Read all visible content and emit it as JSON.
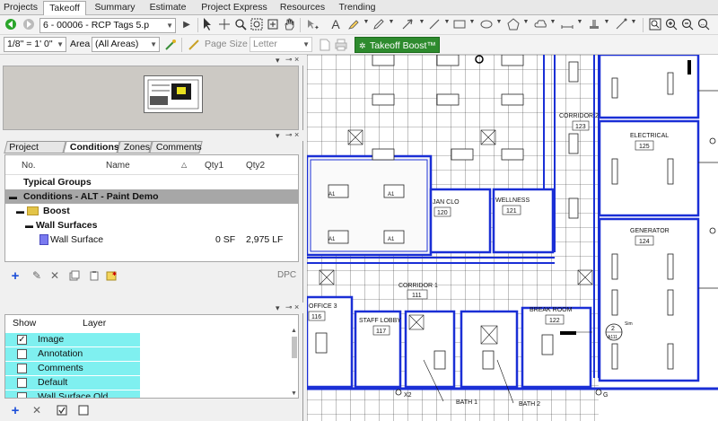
{
  "tabs": [
    "Projects",
    "Takeoff",
    "Summary",
    "Estimate",
    "Project Express",
    "Resources",
    "Trending"
  ],
  "active_tab": "Takeoff",
  "toolbar": {
    "page_select": "6 - 00006 - RCP Tags 5.p",
    "scale": "1/8\" = 1' 0\"",
    "area_label": "Area",
    "area_value": "(All Areas)",
    "page_size_label": "Page Size",
    "page_size_value": "Letter",
    "boost_label": "Takeoff Boost™"
  },
  "condition_tabs": [
    "Project View",
    "Conditions",
    "Zones",
    "Comments"
  ],
  "active_condition_tab": "Conditions",
  "conditions": {
    "columns": [
      "No.",
      "Name",
      "Qty1",
      "Qty2"
    ],
    "rows": [
      {
        "name": "Typical Groups",
        "qty1": "",
        "qty2": "",
        "level": 0,
        "group": false,
        "bold": true
      },
      {
        "name": "Conditions - ALT - Paint Demo",
        "qty1": "",
        "qty2": "",
        "level": 0,
        "group": true,
        "bold": true
      },
      {
        "name": "Boost",
        "qty1": "",
        "qty2": "",
        "level": 1,
        "group": false,
        "bold": true
      },
      {
        "name": "Wall Surfaces",
        "qty1": "",
        "qty2": "",
        "level": 2,
        "group": false,
        "bold": true
      },
      {
        "name": "Wall Surface",
        "qty1": "0 SF",
        "qty2": "2,975 LF",
        "level": 3,
        "group": false,
        "bold": false
      }
    ],
    "dpc_label": "DPC"
  },
  "layers": {
    "columns": [
      "Show",
      "Layer"
    ],
    "rows": [
      {
        "name": "Image",
        "checked": true
      },
      {
        "name": "Annotation",
        "checked": false
      },
      {
        "name": "Comments",
        "checked": false
      },
      {
        "name": "Default",
        "checked": false
      },
      {
        "name": "Wall Surface Old",
        "checked": false
      }
    ]
  },
  "drawing": {
    "rooms": [
      {
        "name": "CORRIDOR 2",
        "num": "123"
      },
      {
        "name": "ELECTRICAL",
        "num": "125"
      },
      {
        "name": "GENERATOR",
        "num": "124"
      },
      {
        "name": "JAN CLO",
        "num": "120"
      },
      {
        "name": "WELLNESS",
        "num": "121"
      },
      {
        "name": "CORRIDOR 1",
        "num": "111"
      },
      {
        "name": "OFFICE 3",
        "num": "116"
      },
      {
        "name": "STAFF LOBBY",
        "num": "117"
      },
      {
        "name": "BREAK ROOM",
        "num": "122"
      }
    ],
    "labels": [
      "BATH 1",
      "BATH 2",
      "X2",
      "G",
      "Sim",
      "2",
      "A111"
    ],
    "colors": {
      "wall": "#1a2fd6",
      "line": "#222222"
    }
  }
}
